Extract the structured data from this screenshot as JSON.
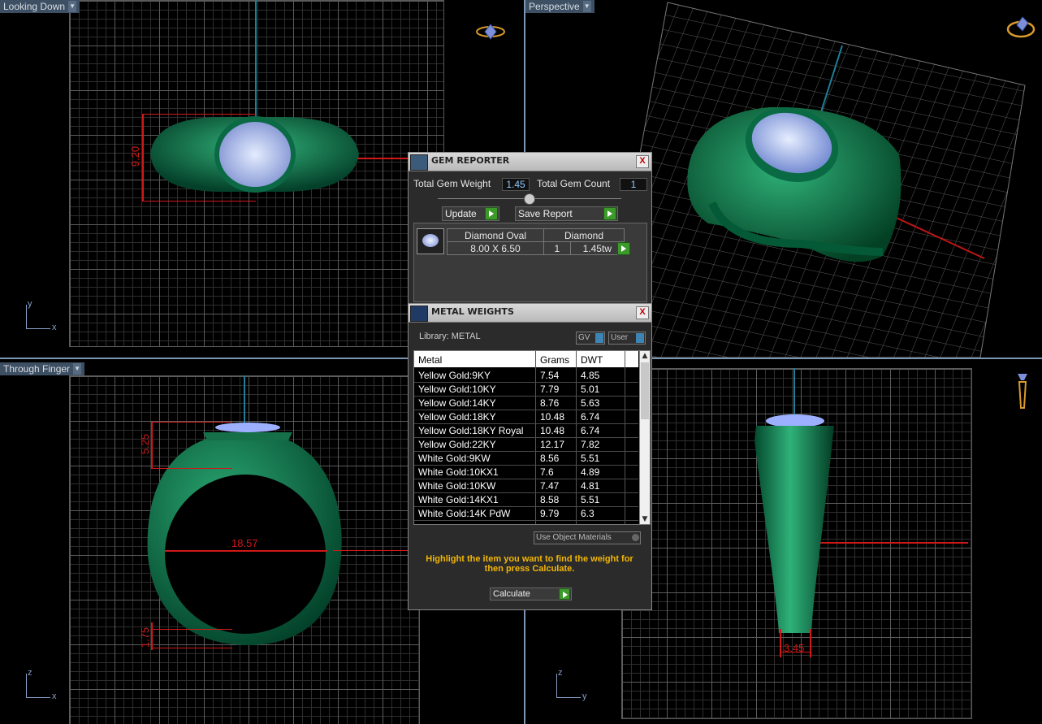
{
  "viewports": {
    "top_left": {
      "label": "Looking Down",
      "axes": {
        "v": "y",
        "h": "x"
      },
      "dim": "9.20"
    },
    "top_right": {
      "label": "Perspective"
    },
    "bottom_left": {
      "label": "Through Finger",
      "axes": {
        "v": "z",
        "h": "x"
      },
      "dims": {
        "top": "5.25",
        "width": "18.57",
        "bottom": "1.75"
      }
    },
    "bottom_right": {
      "axes": {
        "v": "z",
        "h": "y"
      },
      "dim": "3.45"
    }
  },
  "gem_reporter": {
    "title": "GEM REPORTER",
    "close": "X",
    "total_weight_label": "Total Gem Weight",
    "total_weight_value": "1.45",
    "total_count_label": "Total Gem Count",
    "total_count_value": "1",
    "update_label": "Update",
    "save_label": "Save Report",
    "row": {
      "shape": "Diamond Oval",
      "material": "Diamond",
      "size": "8.00 X 6.50",
      "qty": "1",
      "weight": "1.45tw"
    }
  },
  "metal_weights": {
    "title": "METAL WEIGHTS",
    "close": "X",
    "library_label": "Library: METAL",
    "gv_label": "GV",
    "user_label": "User",
    "columns": [
      "Metal",
      "Grams",
      "DWT"
    ],
    "rows": [
      {
        "metal": "Yellow Gold:9KY",
        "grams": "7.54",
        "dwt": "4.85"
      },
      {
        "metal": "Yellow Gold:10KY",
        "grams": "7.79",
        "dwt": "5.01"
      },
      {
        "metal": "Yellow Gold:14KY",
        "grams": "8.76",
        "dwt": "5.63"
      },
      {
        "metal": "Yellow Gold:18KY",
        "grams": "10.48",
        "dwt": "6.74"
      },
      {
        "metal": "Yellow Gold:18KY Royal",
        "grams": "10.48",
        "dwt": "6.74"
      },
      {
        "metal": "Yellow Gold:22KY",
        "grams": "12.17",
        "dwt": "7.82"
      },
      {
        "metal": "White Gold:9KW",
        "grams": "8.56",
        "dwt": "5.51"
      },
      {
        "metal": "White Gold:10KX1",
        "grams": "7.6",
        "dwt": "4.89"
      },
      {
        "metal": "White Gold:10KW",
        "grams": "7.47",
        "dwt": "4.81"
      },
      {
        "metal": "White Gold:14KX1",
        "grams": "8.58",
        "dwt": "5.51"
      },
      {
        "metal": "White Gold:14K PdW",
        "grams": "9.79",
        "dwt": "6.3"
      }
    ],
    "use_object_materials": "Use Object Materials",
    "instruction": "Highlight the item you want to find the weight for then press Calculate.",
    "calculate_label": "Calculate"
  }
}
